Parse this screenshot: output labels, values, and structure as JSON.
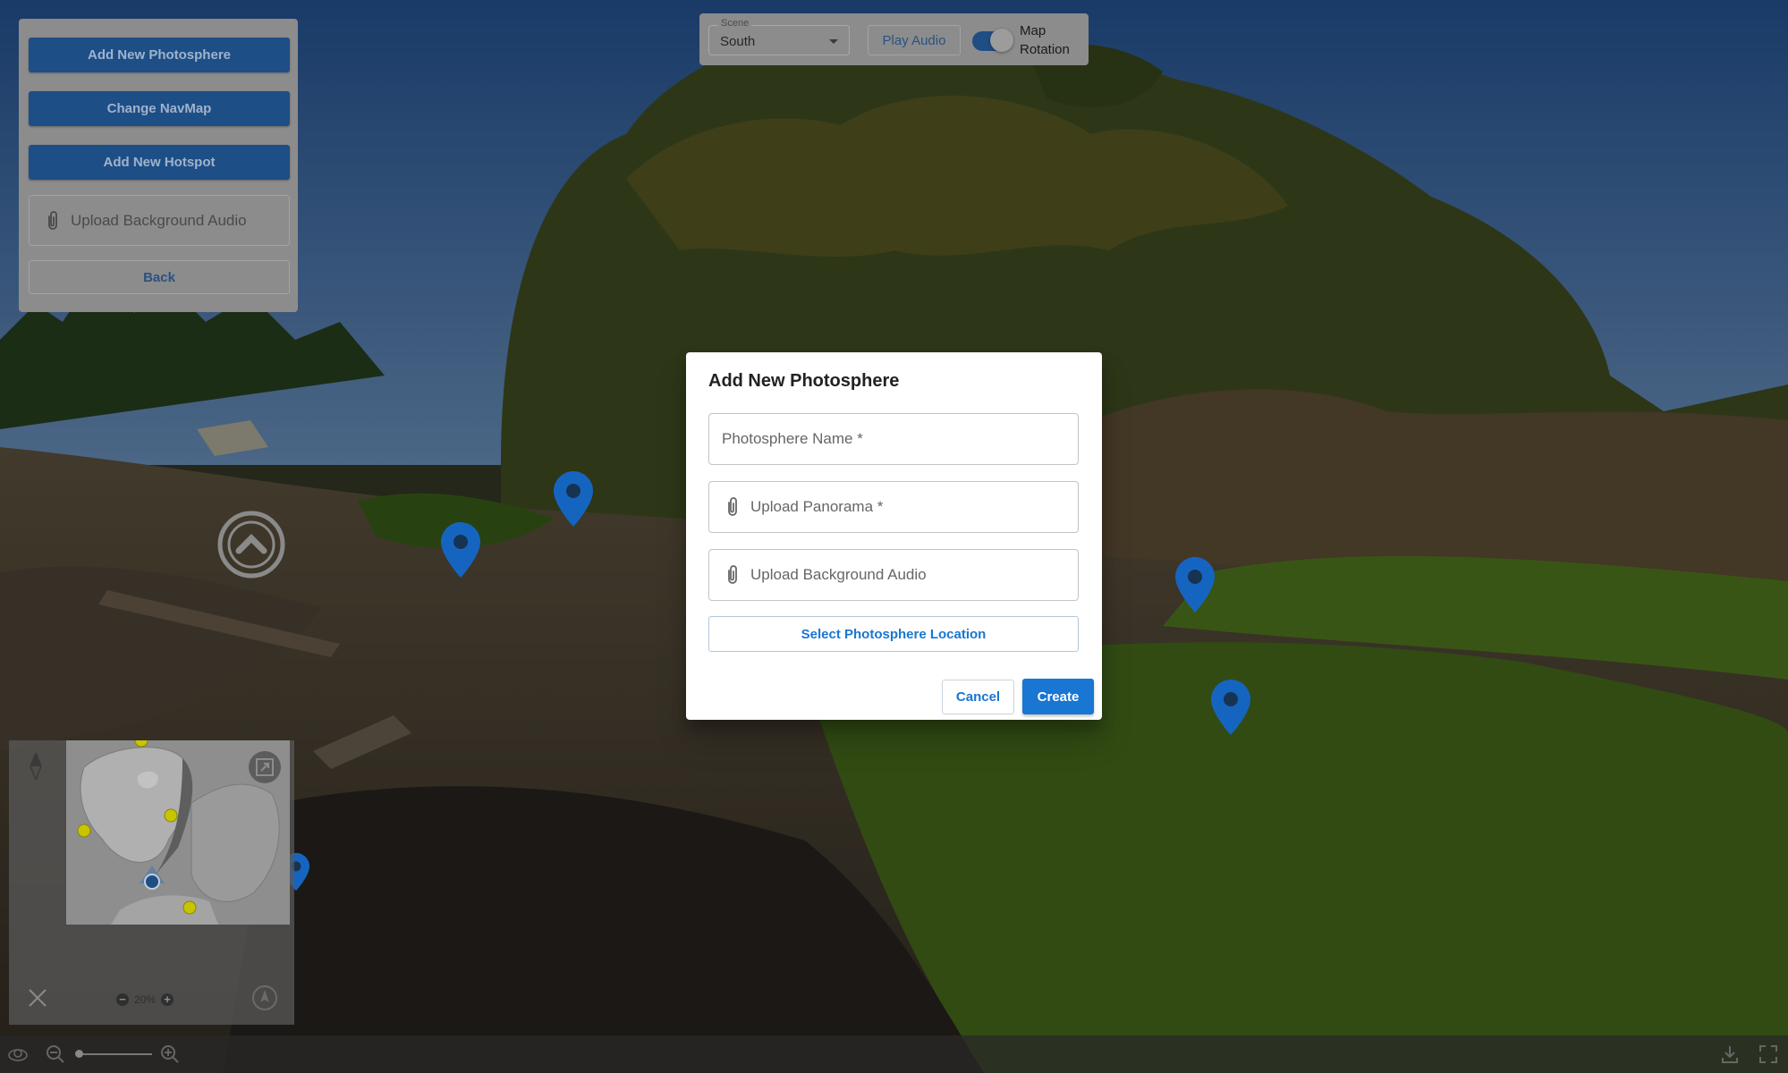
{
  "edit_panel": {
    "add_photosphere": "Add New Photosphere",
    "change_navmap": "Change NavMap",
    "add_hotspot": "Add New Hotspot",
    "upload_audio": "Upload Background Audio",
    "back": "Back"
  },
  "toolbar": {
    "scene_label": "Scene",
    "scene_value": "South",
    "play_audio": "Play Audio",
    "map_rotation_line1": "Map",
    "map_rotation_line2": "Rotation",
    "map_rotation_on": true
  },
  "modal": {
    "title": "Add New Photosphere",
    "name_placeholder": "Photosphere Name *",
    "panorama_placeholder": "Upload Panorama *",
    "audio_placeholder": "Upload Background Audio",
    "select_location": "Select Photosphere Location",
    "cancel": "Cancel",
    "create": "Create"
  },
  "minimap": {
    "zoom": "20%"
  },
  "icons": {
    "attach": "paperclip-icon",
    "marker": "map-marker-icon",
    "compass": "compass-icon",
    "expand": "expand-icon",
    "close": "close-icon",
    "locate": "locate-icon"
  },
  "colors": {
    "primary": "#1976d2",
    "panel_button": "#1e4e86",
    "marker": "#1565c0",
    "map_point": "#c9c400"
  }
}
